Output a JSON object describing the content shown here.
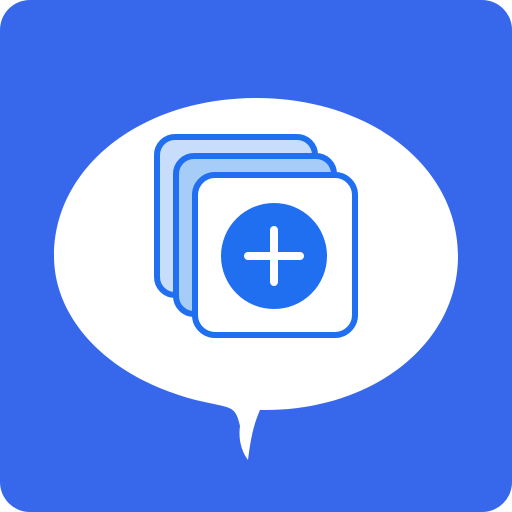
{
  "icon": {
    "name": "chat-bubble-add-cards-icon",
    "glyph": "plus"
  },
  "colors": {
    "background": "#3768eb",
    "bubble": "#ffffff",
    "outline": "#1f6ff0",
    "card_fill_back": "#c7ddfb",
    "card_fill_middle": "#a6ccf8",
    "card_fill_front": "#ffffff",
    "plus_circle": "#1f6ff0",
    "plus_sign": "#ffffff"
  }
}
